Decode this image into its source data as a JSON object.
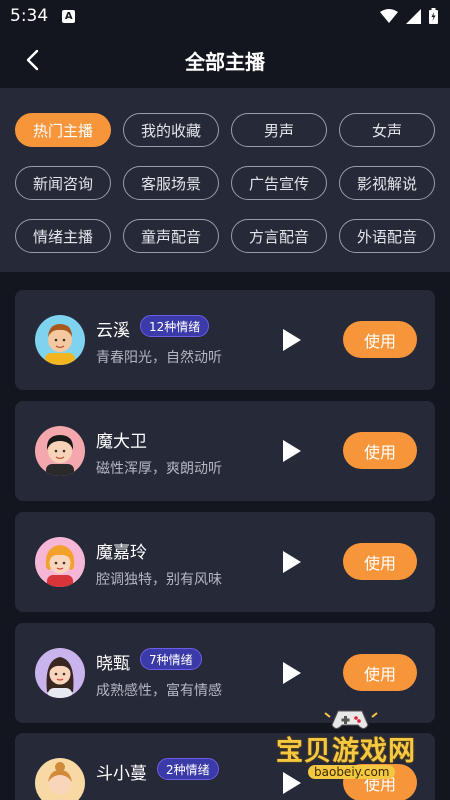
{
  "status": {
    "time": "5:34"
  },
  "header": {
    "title": "全部主播"
  },
  "filters": [
    "热门主播",
    "我的收藏",
    "男声",
    "女声",
    "新闻咨询",
    "客服场景",
    "广告宣传",
    "影视解说",
    "情绪主播",
    "童声配音",
    "方言配音",
    "外语配音"
  ],
  "active_filter": "热门主播",
  "anchors": [
    {
      "name": "云溪",
      "badge": "12种情绪",
      "desc": "青春阳光，自然动听",
      "use": "使用"
    },
    {
      "name": "魔大卫",
      "badge": "",
      "desc": "磁性浑厚，爽朗动听",
      "use": "使用"
    },
    {
      "name": "魔嘉玲",
      "badge": "",
      "desc": "腔调独特，别有风味",
      "use": "使用"
    },
    {
      "name": "晓甄",
      "badge": "7种情绪",
      "desc": "成熟感性，富有情感",
      "use": "使用"
    },
    {
      "name": "斗小蔓",
      "badge": "2种情绪",
      "desc": "",
      "use": "使用"
    }
  ],
  "watermark": {
    "title": "宝贝游戏网",
    "url": "baobeiy.com"
  },
  "colors": {
    "accent": "#f7953a",
    "bg": "#14161f",
    "card": "#262937"
  }
}
